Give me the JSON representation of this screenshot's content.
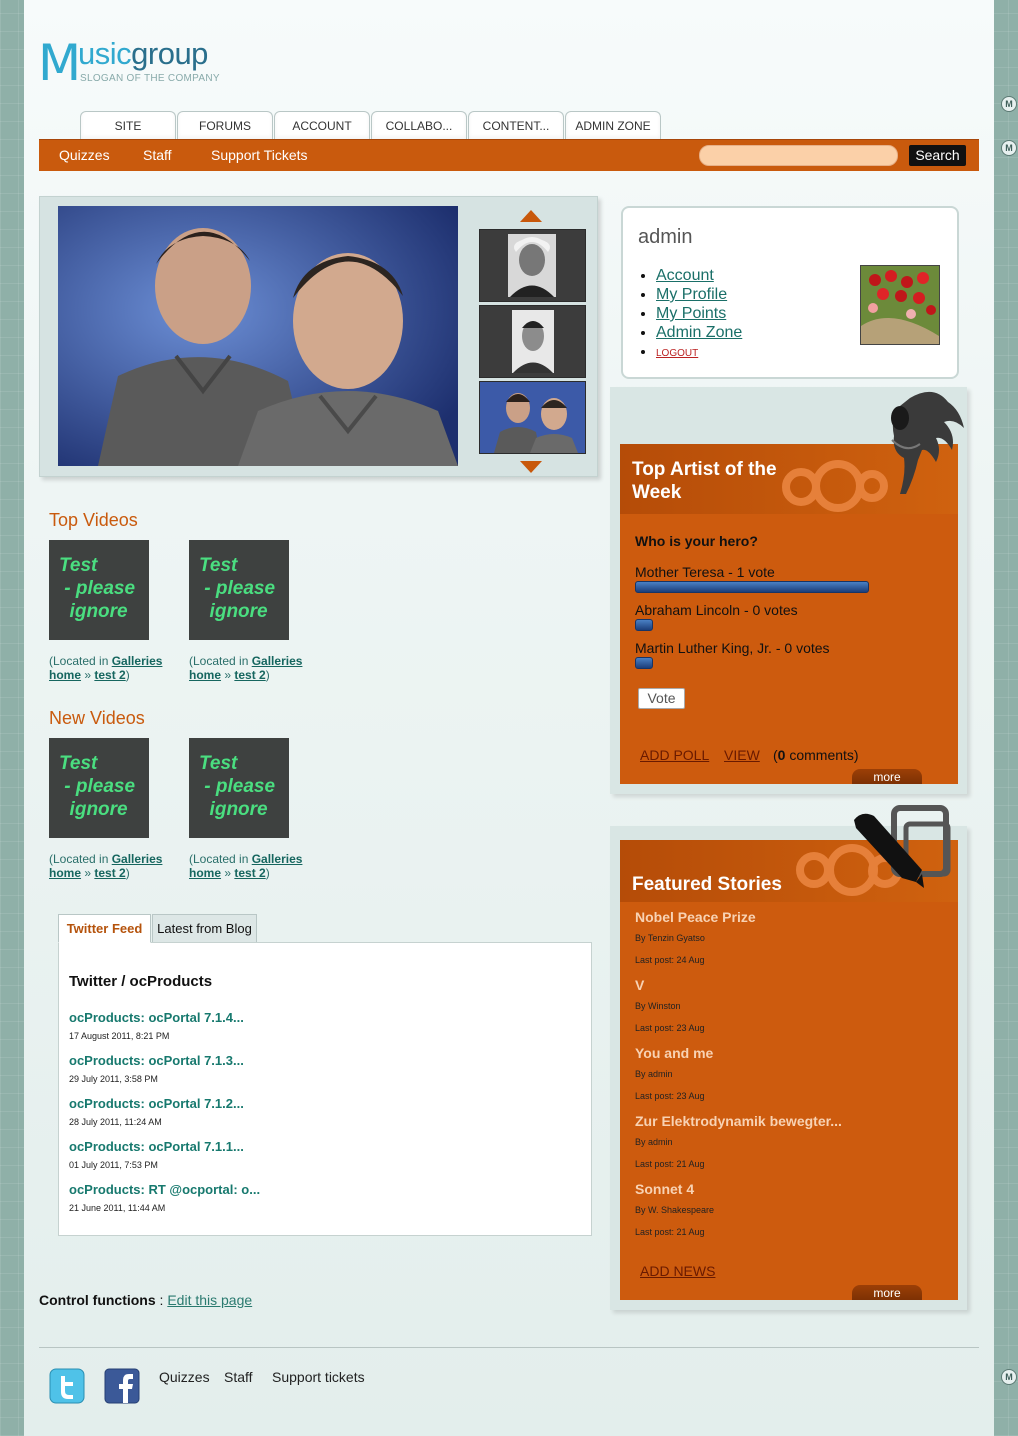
{
  "logo": {
    "initial": "M",
    "word_a": "usic",
    "word_b": "group",
    "slogan": "SLOGAN OF THE COMPANY"
  },
  "tabs": [
    "SITE",
    "FORUMS",
    "ACCOUNT",
    "COLLABO...",
    "CONTENT...",
    "ADMIN ZONE"
  ],
  "subnav": {
    "items": [
      "Quizzes",
      "Staff",
      "Support Tickets"
    ],
    "search_label": "Search",
    "search_value": ""
  },
  "top_videos": {
    "title": "Top Videos",
    "items": [
      {
        "thumb_text": "Test\n - please\n  ignore",
        "located_prefix": "(Located in ",
        "gallery": "Galleries",
        "home": "home",
        "sep": " » ",
        "album": "test 2",
        "close": ")"
      },
      {
        "thumb_text": "Test\n - please\n  ignore",
        "located_prefix": "(Located in ",
        "gallery": "Galleries",
        "home": "home",
        "sep": " » ",
        "album": "test 2",
        "close": ")"
      }
    ]
  },
  "new_videos": {
    "title": "New Videos",
    "items": [
      {
        "thumb_text": "Test\n - please\n  ignore",
        "located_prefix": "(Located in ",
        "gallery": "Galleries",
        "home": "home",
        "sep": " » ",
        "album": "test 2",
        "close": ")"
      },
      {
        "thumb_text": "Test\n - please\n  ignore",
        "located_prefix": "(Located in ",
        "gallery": "Galleries",
        "home": "home",
        "sep": " » ",
        "album": "test 2",
        "close": ")"
      }
    ]
  },
  "feed_tabs": [
    "Twitter Feed",
    "Latest from Blog"
  ],
  "twitter": {
    "title": "Twitter / ocProducts",
    "items": [
      {
        "text": "ocProducts: ocPortal 7.1.4...",
        "date": "17 August 2011, 8:21 PM"
      },
      {
        "text": "ocProducts: ocPortal 7.1.3...",
        "date": "29 July 2011, 3:58 PM"
      },
      {
        "text": "ocProducts: ocPortal 7.1.2...",
        "date": "28 July 2011, 11:24 AM"
      },
      {
        "text": "ocProducts: ocPortal 7.1.1...",
        "date": "01 July 2011, 7:53 PM"
      },
      {
        "text": "ocProducts: RT @ocportal: o...",
        "date": "21 June 2011, 11:44 AM"
      }
    ]
  },
  "control": {
    "label": "Control functions",
    "sep": " : ",
    "link": "Edit this page"
  },
  "admin": {
    "name": "admin",
    "links": [
      "Account",
      "My Profile",
      "My Points",
      "Admin Zone"
    ],
    "logout": "LOGOUT"
  },
  "poll": {
    "title": "Top Artist of the Week",
    "question": "Who is your hero?",
    "options": [
      {
        "label": "Mother Teresa - 1 vote",
        "votes": 1
      },
      {
        "label": "Abraham Lincoln - 0 votes",
        "votes": 0
      },
      {
        "label": "Martin Luther King, Jr. - 0 votes",
        "votes": 0
      }
    ],
    "vote_label": "Vote",
    "add_poll": "ADD POLL",
    "view": "VIEW",
    "comments_open": "(",
    "comments_count": "0",
    "comments_rest": " comments)",
    "more": "more"
  },
  "stories": {
    "title": "Featured Stories",
    "items": [
      {
        "title": "Nobel Peace Prize",
        "by": "By Tenzin Gyatso",
        "last": "Last post: 24 Aug"
      },
      {
        "title": "V",
        "by": "By Winston",
        "last": "Last post: 23 Aug"
      },
      {
        "title": "You and me",
        "by": "By admin",
        "last": "Last post: 23 Aug"
      },
      {
        "title": "Zur Elektrodynamik bewegter...",
        "by": "By admin",
        "last": "Last post: 21 Aug"
      },
      {
        "title": "Sonnet 4",
        "by": "By W. Shakespeare",
        "last": "Last post: 21 Aug"
      }
    ],
    "add_news": "ADD NEWS",
    "more": "more"
  },
  "footer": {
    "links": [
      "Quizzes",
      "Staff",
      "Support tickets"
    ]
  },
  "colors": {
    "accent": "#c95a0d",
    "brand": "#31a9cf",
    "link": "#1a6f68"
  }
}
